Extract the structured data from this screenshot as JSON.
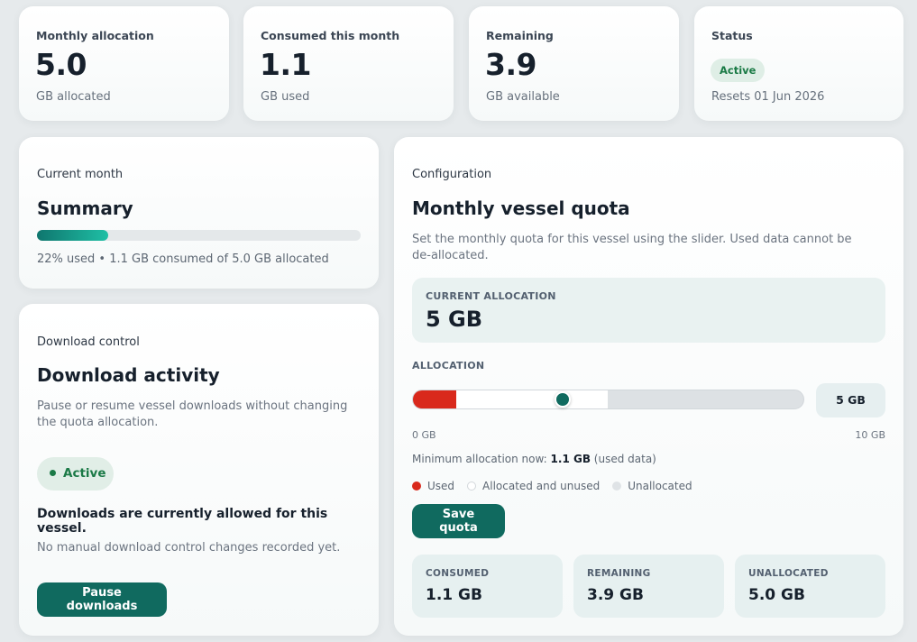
{
  "stats": [
    {
      "label": "Monthly allocation",
      "value": "5.0",
      "sub": "GB allocated"
    },
    {
      "label": "Consumed this month",
      "value": "1.1",
      "sub": "GB used"
    },
    {
      "label": "Remaining",
      "value": "3.9",
      "sub": "GB available"
    },
    {
      "label": "Status",
      "badge": "Active",
      "sub": "Resets 01 Jun 2026"
    }
  ],
  "summary": {
    "eyebrow": "Current month",
    "title": "Summary",
    "progress_fraction": 0.22,
    "progress_color": "#0f766e",
    "text": "22% used • 1.1 GB consumed of 5.0 GB allocated"
  },
  "download": {
    "eyebrow": "Download control",
    "title": "Download activity",
    "description": "Pause or resume vessel downloads without changing the quota allocation.",
    "status": "Active",
    "status_message": "Downloads are currently allowed for this vessel.",
    "history": "No manual download control changes recorded yet.",
    "button_label": "Pause downloads"
  },
  "config": {
    "eyebrow": "Configuration",
    "title": "Monthly vessel quota",
    "description": "Set the monthly quota for this vessel using the slider. Used data cannot be de-allocated.",
    "current_label": "CURRENT ALLOCATION",
    "current_value": "5 GB",
    "section_label": "ALLOCATION",
    "slider": {
      "min": 0,
      "max": 10,
      "used": 1.1,
      "allocated": 5
    },
    "value_chip": "5 GB",
    "scale_min": "0 GB",
    "scale_max": "10 GB",
    "min_note_prefix": "Minimum allocation now:",
    "min_note_value": "1.1 GB",
    "min_note_suffix": "(used data)",
    "legend": [
      {
        "label": "Used",
        "color": "#d9291c"
      },
      {
        "label": "Allocated and unused",
        "color": "#ffffff"
      },
      {
        "label": "Unallocated",
        "color": "#dfe3e6"
      }
    ],
    "save_label": "Save quota",
    "totals": [
      {
        "label": "CONSUMED",
        "value": "1.1 GB"
      },
      {
        "label": "REMAINING",
        "value": "3.9 GB"
      },
      {
        "label": "UNALLOCATED",
        "value": "5.0 GB"
      }
    ]
  },
  "colors": {
    "accent": "#106a5f",
    "used": "#d9291c",
    "active_green": "#1b7a47"
  }
}
